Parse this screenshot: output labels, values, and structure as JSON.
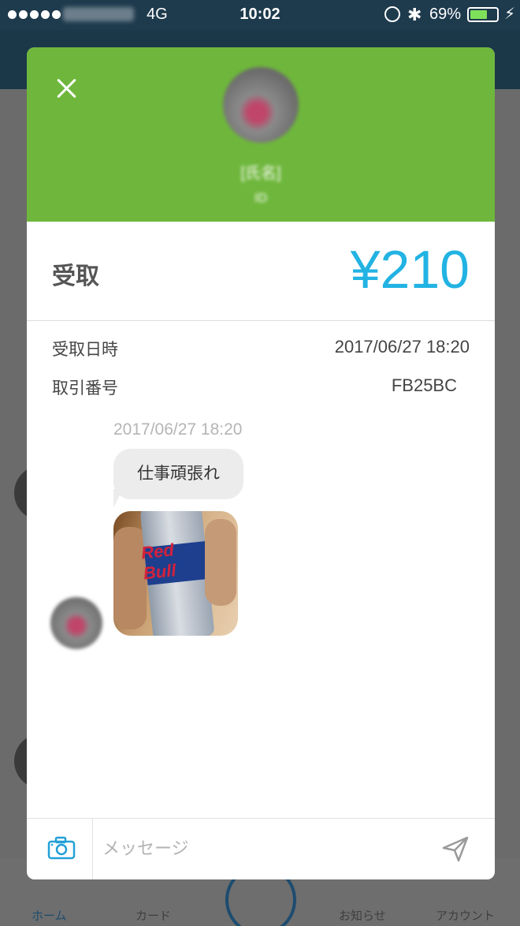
{
  "status_bar": {
    "network": "4G",
    "time": "10:02",
    "battery_percent": "69%",
    "battery_level": 0.69
  },
  "background_tabs": [
    {
      "label": "ホーム",
      "active": true
    },
    {
      "label": "カード",
      "active": false
    },
    {
      "label": "お知らせ",
      "active": false
    },
    {
      "label": "アカウント",
      "active": false
    }
  ],
  "modal": {
    "header_color": "#6fb73c",
    "sender_name": "[氏名]",
    "sender_sub": "ID",
    "amount_label": "受取",
    "amount_value": "¥210",
    "amount_color": "#22b3e3",
    "details": [
      {
        "label": "受取日時",
        "value": "2017/06/27 18:20"
      },
      {
        "label": "取引番号",
        "value": "FB25BC"
      }
    ],
    "message": {
      "timestamp": "2017/06/27 18:20",
      "text": "仕事頑張れ",
      "image_text": "Red Bull"
    },
    "input": {
      "placeholder": "メッセージ"
    },
    "icons": {
      "close": "close-icon",
      "camera": "camera-icon",
      "send": "send-icon"
    }
  }
}
